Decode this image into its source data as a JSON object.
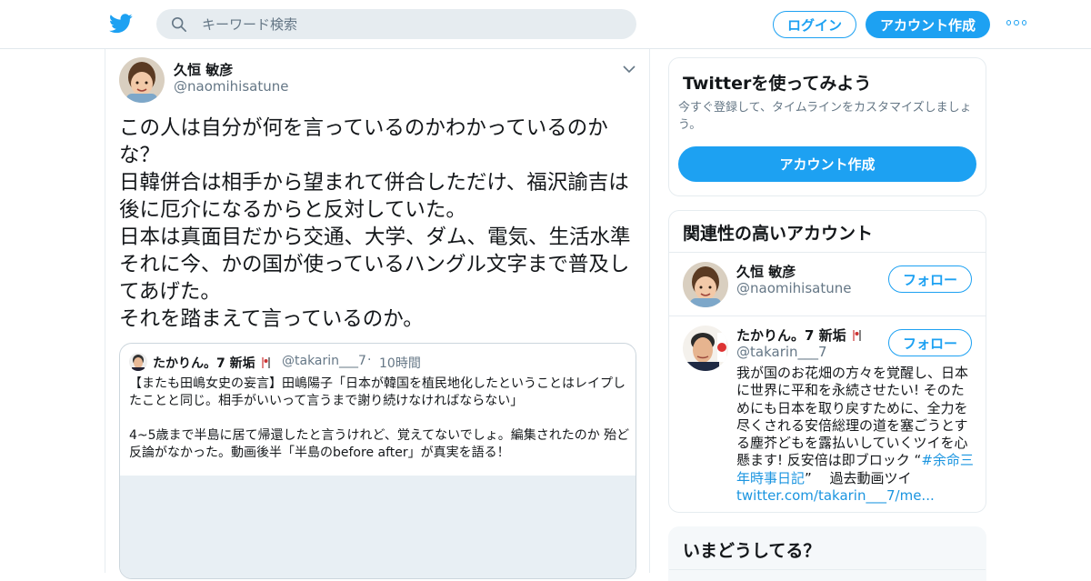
{
  "header": {
    "search_placeholder": "キーワード検索",
    "login_label": "ログイン",
    "signup_label": "アカウント作成"
  },
  "tweet": {
    "author_name": "久恒 敏彦",
    "author_handle": "@naomihisatune",
    "text": "この人は自分が何を言っているのかわかっているのかな？\n日韓併合は相手から望まれて併合しただけ、福沢諭吉は後に厄介になるからと反対していた。\n日本は真面目だから交通、大学、ダム、電気、生活水準それに今、かの国が使っているハングル文字まで普及してあげた。\nそれを踏まえて言っているのか。",
    "quoted": {
      "author_name": "たかりん。7 新垢",
      "author_handle": "@takarin___7",
      "separator": "·",
      "time": "10時間",
      "text": "【またも田嶋女史の妄言】田嶋陽子「日本が韓国を植民地化したということはレイプしたことと同じ。相手がいいって言うまで謝り続けなければならない」\n\n4~5歳まで半島に居て帰還したと言うけれど、覚えてないでしょ。編集されたのか 殆ど反論がなかった。動画後半「半島のbefore after」が真実を語る！"
    }
  },
  "signup_panel": {
    "title": "Twitterを使ってみよう",
    "description": "今すぐ登録して、タイムラインをカスタマイズしましょう。",
    "button_label": "アカウント作成"
  },
  "related_panel": {
    "title": "関連性の高いアカウント",
    "accounts": [
      {
        "name": "久恒 敏彦",
        "handle": "@naomihisatune",
        "follow_label": "フォロー"
      },
      {
        "name": "たかりん。7 新垢",
        "handle": "@takarin___7",
        "follow_label": "フォロー",
        "bio_text": "我が国のお花畑の方々を覚醒し、日本に世界に平和を永続させたい! そのためにも日本を取り戻すために、全力を尽くされる安倍総理の道を塞ごうとする塵芥どもを露払いしていくツイを心懸ます! 反安倍は即ブロック “",
        "bio_hashtag": "#余命三年時事日記",
        "bio_after": "” 　過去動画ツイ ",
        "bio_link": "twitter.com/takarin___7/me..."
      }
    ]
  },
  "trends_panel": {
    "title": "いまどうしてる？"
  },
  "icons": {
    "logo": "twitter-bird-icon",
    "search": "search-icon",
    "more": "more-icon",
    "caret": "chevron-down-icon",
    "flag": "flag-icon"
  },
  "colors": {
    "accent": "#1da1f2",
    "secondary_text": "#657786",
    "border": "#e6ecf0",
    "link": "#1b95e0"
  }
}
